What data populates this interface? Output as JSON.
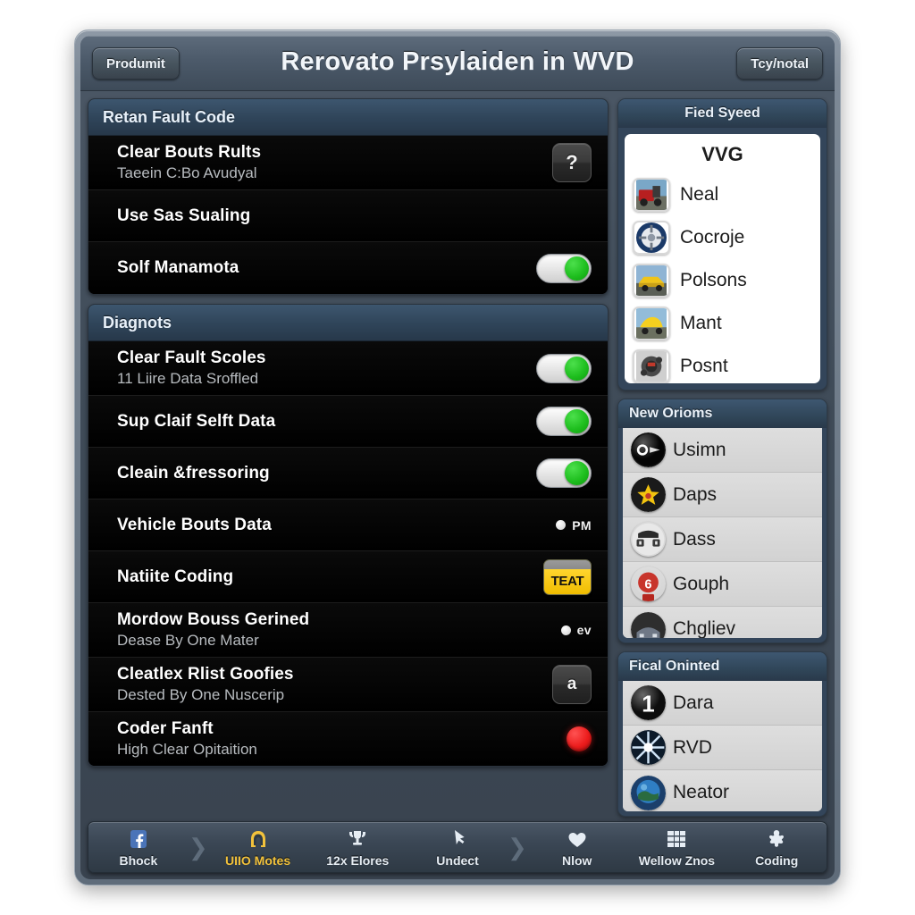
{
  "window": {
    "title": "Rerovato Prsylaiden in WVD",
    "left_button": "Produmit",
    "right_button": "Tcy/notal"
  },
  "left_panels": [
    {
      "header": "Retan Fault Code",
      "rows": [
        {
          "title": "Clear Bouts Rults",
          "sub": "Taeein C:Bo Avudyal",
          "control": "help-button",
          "control_label": "?"
        },
        {
          "title": "Use Sas Sualing",
          "sub": "",
          "control": "none",
          "control_label": ""
        },
        {
          "title": "Solf Manamota",
          "sub": "",
          "control": "toggle-on",
          "control_label": ""
        }
      ]
    },
    {
      "header": "Diagnots",
      "rows": [
        {
          "title": "Clear Fault Scoles",
          "sub": "11 Liire Data Sroffled",
          "control": "toggle-on",
          "control_label": ""
        },
        {
          "title": "Sup Claif Selft Data",
          "sub": "",
          "control": "toggle-on",
          "control_label": ""
        },
        {
          "title": "Cleain &fressoring",
          "sub": "",
          "control": "toggle-on",
          "control_label": ""
        },
        {
          "title": "Vehicle Bouts Data",
          "sub": "",
          "control": "dot-label",
          "control_label": "PM"
        },
        {
          "title": "Natiite Coding",
          "sub": "",
          "control": "plate-badge",
          "control_label": "TEAT"
        },
        {
          "title": "Mordow Bouss Gerined",
          "sub": "Dease By One Mater",
          "control": "dot-label",
          "control_label": "ev"
        },
        {
          "title": "Cleatlex Rlist Goofies",
          "sub": "Dested By One Nuscerip",
          "control": "glyph-button",
          "control_label": "a"
        },
        {
          "title": "Coder Fanft",
          "sub": "High Clear Opitaition",
          "control": "led-red",
          "control_label": ""
        }
      ]
    }
  ],
  "side_panels": [
    {
      "header": "Fied Syeed",
      "style": "white",
      "list_title": "VVG",
      "items": [
        {
          "label": "Neal",
          "icon": "truck-thumbnail"
        },
        {
          "label": "Cocroje",
          "icon": "wheel-badge-thumbnail"
        },
        {
          "label": "Polsons",
          "icon": "sports-car-thumbnail"
        },
        {
          "label": "Mant",
          "icon": "yellow-car-thumbnail"
        },
        {
          "label": "Posnt",
          "icon": "engine-thumbnail"
        }
      ]
    },
    {
      "header": "New Orioms",
      "style": "gray",
      "items": [
        {
          "label": "Usimn",
          "icon": "black-badge-icon"
        },
        {
          "label": "Daps",
          "icon": "yellow-star-icon"
        },
        {
          "label": "Dass",
          "icon": "device-icon"
        },
        {
          "label": "Gouph",
          "icon": "red-meter-icon"
        },
        {
          "label": "Chgliev",
          "icon": "car-front-icon"
        }
      ]
    },
    {
      "header": "Fical Oninted",
      "style": "gray",
      "items": [
        {
          "label": "Dara",
          "icon": "number-one-icon"
        },
        {
          "label": "RVD",
          "icon": "starburst-icon"
        },
        {
          "label": "Neator",
          "icon": "globe-icon"
        }
      ]
    }
  ],
  "bottom_nav": [
    {
      "label": "Bhock",
      "icon": "facebook-icon",
      "accent": false
    },
    {
      "label": "UIIO Motes",
      "icon": "arch-icon",
      "accent": true
    },
    {
      "label": "12x Elores",
      "icon": "trophy-icon",
      "accent": false
    },
    {
      "label": "Undect",
      "icon": "cursor-icon",
      "accent": false
    },
    {
      "label": "Nlow",
      "icon": "heart-icon",
      "accent": false
    },
    {
      "label": "Wellow Znos",
      "icon": "grid-icon",
      "accent": false
    },
    {
      "label": "Coding",
      "icon": "person-icon",
      "accent": false
    }
  ],
  "colors": {
    "frame": "#6d7a88",
    "header_blue": "#2f4459",
    "accent_yellow": "#f2c23c",
    "toggle_green": "#1fbf1f",
    "led_red": "#ec1c1c",
    "panel_gray": "#d7d7d7"
  }
}
